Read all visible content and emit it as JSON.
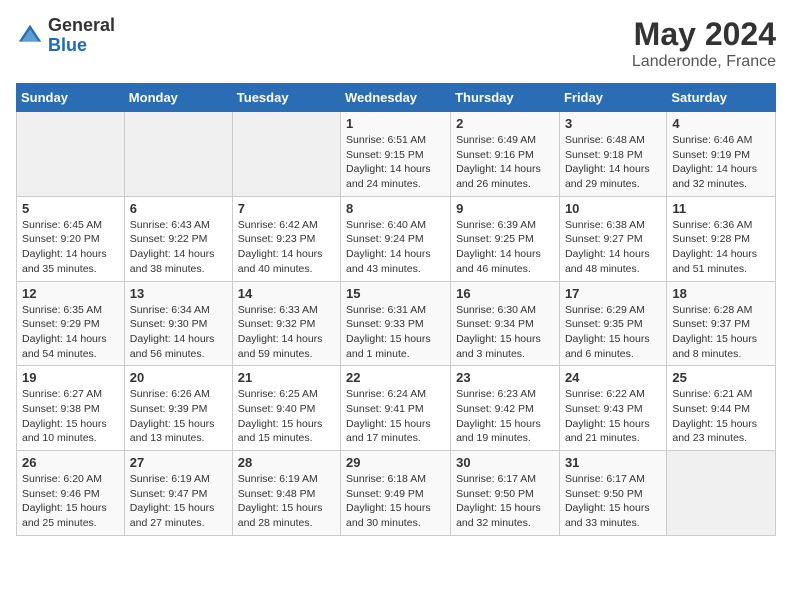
{
  "header": {
    "logo_general": "General",
    "logo_blue": "Blue",
    "month_year": "May 2024",
    "location": "Landeronde, France"
  },
  "days_of_week": [
    "Sunday",
    "Monday",
    "Tuesday",
    "Wednesday",
    "Thursday",
    "Friday",
    "Saturday"
  ],
  "weeks": [
    [
      {
        "day": "",
        "info": ""
      },
      {
        "day": "",
        "info": ""
      },
      {
        "day": "",
        "info": ""
      },
      {
        "day": "1",
        "info": "Sunrise: 6:51 AM\nSunset: 9:15 PM\nDaylight: 14 hours\nand 24 minutes."
      },
      {
        "day": "2",
        "info": "Sunrise: 6:49 AM\nSunset: 9:16 PM\nDaylight: 14 hours\nand 26 minutes."
      },
      {
        "day": "3",
        "info": "Sunrise: 6:48 AM\nSunset: 9:18 PM\nDaylight: 14 hours\nand 29 minutes."
      },
      {
        "day": "4",
        "info": "Sunrise: 6:46 AM\nSunset: 9:19 PM\nDaylight: 14 hours\nand 32 minutes."
      }
    ],
    [
      {
        "day": "5",
        "info": "Sunrise: 6:45 AM\nSunset: 9:20 PM\nDaylight: 14 hours\nand 35 minutes."
      },
      {
        "day": "6",
        "info": "Sunrise: 6:43 AM\nSunset: 9:22 PM\nDaylight: 14 hours\nand 38 minutes."
      },
      {
        "day": "7",
        "info": "Sunrise: 6:42 AM\nSunset: 9:23 PM\nDaylight: 14 hours\nand 40 minutes."
      },
      {
        "day": "8",
        "info": "Sunrise: 6:40 AM\nSunset: 9:24 PM\nDaylight: 14 hours\nand 43 minutes."
      },
      {
        "day": "9",
        "info": "Sunrise: 6:39 AM\nSunset: 9:25 PM\nDaylight: 14 hours\nand 46 minutes."
      },
      {
        "day": "10",
        "info": "Sunrise: 6:38 AM\nSunset: 9:27 PM\nDaylight: 14 hours\nand 48 minutes."
      },
      {
        "day": "11",
        "info": "Sunrise: 6:36 AM\nSunset: 9:28 PM\nDaylight: 14 hours\nand 51 minutes."
      }
    ],
    [
      {
        "day": "12",
        "info": "Sunrise: 6:35 AM\nSunset: 9:29 PM\nDaylight: 14 hours\nand 54 minutes."
      },
      {
        "day": "13",
        "info": "Sunrise: 6:34 AM\nSunset: 9:30 PM\nDaylight: 14 hours\nand 56 minutes."
      },
      {
        "day": "14",
        "info": "Sunrise: 6:33 AM\nSunset: 9:32 PM\nDaylight: 14 hours\nand 59 minutes."
      },
      {
        "day": "15",
        "info": "Sunrise: 6:31 AM\nSunset: 9:33 PM\nDaylight: 15 hours\nand 1 minute."
      },
      {
        "day": "16",
        "info": "Sunrise: 6:30 AM\nSunset: 9:34 PM\nDaylight: 15 hours\nand 3 minutes."
      },
      {
        "day": "17",
        "info": "Sunrise: 6:29 AM\nSunset: 9:35 PM\nDaylight: 15 hours\nand 6 minutes."
      },
      {
        "day": "18",
        "info": "Sunrise: 6:28 AM\nSunset: 9:37 PM\nDaylight: 15 hours\nand 8 minutes."
      }
    ],
    [
      {
        "day": "19",
        "info": "Sunrise: 6:27 AM\nSunset: 9:38 PM\nDaylight: 15 hours\nand 10 minutes."
      },
      {
        "day": "20",
        "info": "Sunrise: 6:26 AM\nSunset: 9:39 PM\nDaylight: 15 hours\nand 13 minutes."
      },
      {
        "day": "21",
        "info": "Sunrise: 6:25 AM\nSunset: 9:40 PM\nDaylight: 15 hours\nand 15 minutes."
      },
      {
        "day": "22",
        "info": "Sunrise: 6:24 AM\nSunset: 9:41 PM\nDaylight: 15 hours\nand 17 minutes."
      },
      {
        "day": "23",
        "info": "Sunrise: 6:23 AM\nSunset: 9:42 PM\nDaylight: 15 hours\nand 19 minutes."
      },
      {
        "day": "24",
        "info": "Sunrise: 6:22 AM\nSunset: 9:43 PM\nDaylight: 15 hours\nand 21 minutes."
      },
      {
        "day": "25",
        "info": "Sunrise: 6:21 AM\nSunset: 9:44 PM\nDaylight: 15 hours\nand 23 minutes."
      }
    ],
    [
      {
        "day": "26",
        "info": "Sunrise: 6:20 AM\nSunset: 9:46 PM\nDaylight: 15 hours\nand 25 minutes."
      },
      {
        "day": "27",
        "info": "Sunrise: 6:19 AM\nSunset: 9:47 PM\nDaylight: 15 hours\nand 27 minutes."
      },
      {
        "day": "28",
        "info": "Sunrise: 6:19 AM\nSunset: 9:48 PM\nDaylight: 15 hours\nand 28 minutes."
      },
      {
        "day": "29",
        "info": "Sunrise: 6:18 AM\nSunset: 9:49 PM\nDaylight: 15 hours\nand 30 minutes."
      },
      {
        "day": "30",
        "info": "Sunrise: 6:17 AM\nSunset: 9:50 PM\nDaylight: 15 hours\nand 32 minutes."
      },
      {
        "day": "31",
        "info": "Sunrise: 6:17 AM\nSunset: 9:50 PM\nDaylight: 15 hours\nand 33 minutes."
      },
      {
        "day": "",
        "info": ""
      }
    ]
  ]
}
